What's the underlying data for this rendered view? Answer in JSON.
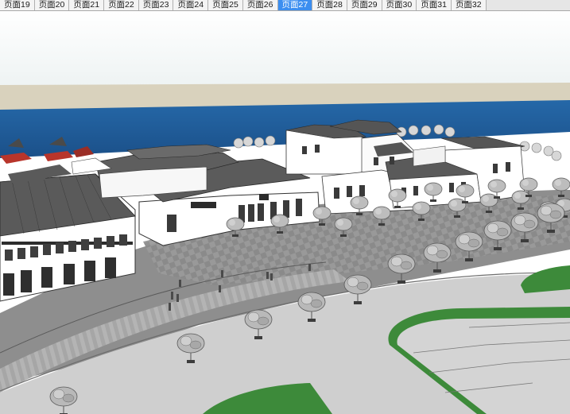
{
  "tabs": [
    {
      "label": "页面19"
    },
    {
      "label": "页面20"
    },
    {
      "label": "页面21"
    },
    {
      "label": "页面22"
    },
    {
      "label": "页面23"
    },
    {
      "label": "页面24"
    },
    {
      "label": "页面25"
    },
    {
      "label": "页面26"
    },
    {
      "label": "页面27",
      "active": true
    },
    {
      "label": "页面28"
    },
    {
      "label": "页面29"
    },
    {
      "label": "页面30"
    },
    {
      "label": "页面31"
    },
    {
      "label": "页面32"
    }
  ],
  "colors": {
    "sky": "#ffffff",
    "horizon": "#d9d2bd",
    "water": "#1f5d9a",
    "plaza": "#8e8e8e",
    "road": "#cfcfcf",
    "grass": "#3d8a3a",
    "tab_active": "#3c8ef0"
  },
  "viewport": {
    "scene": "3d-model-view"
  }
}
